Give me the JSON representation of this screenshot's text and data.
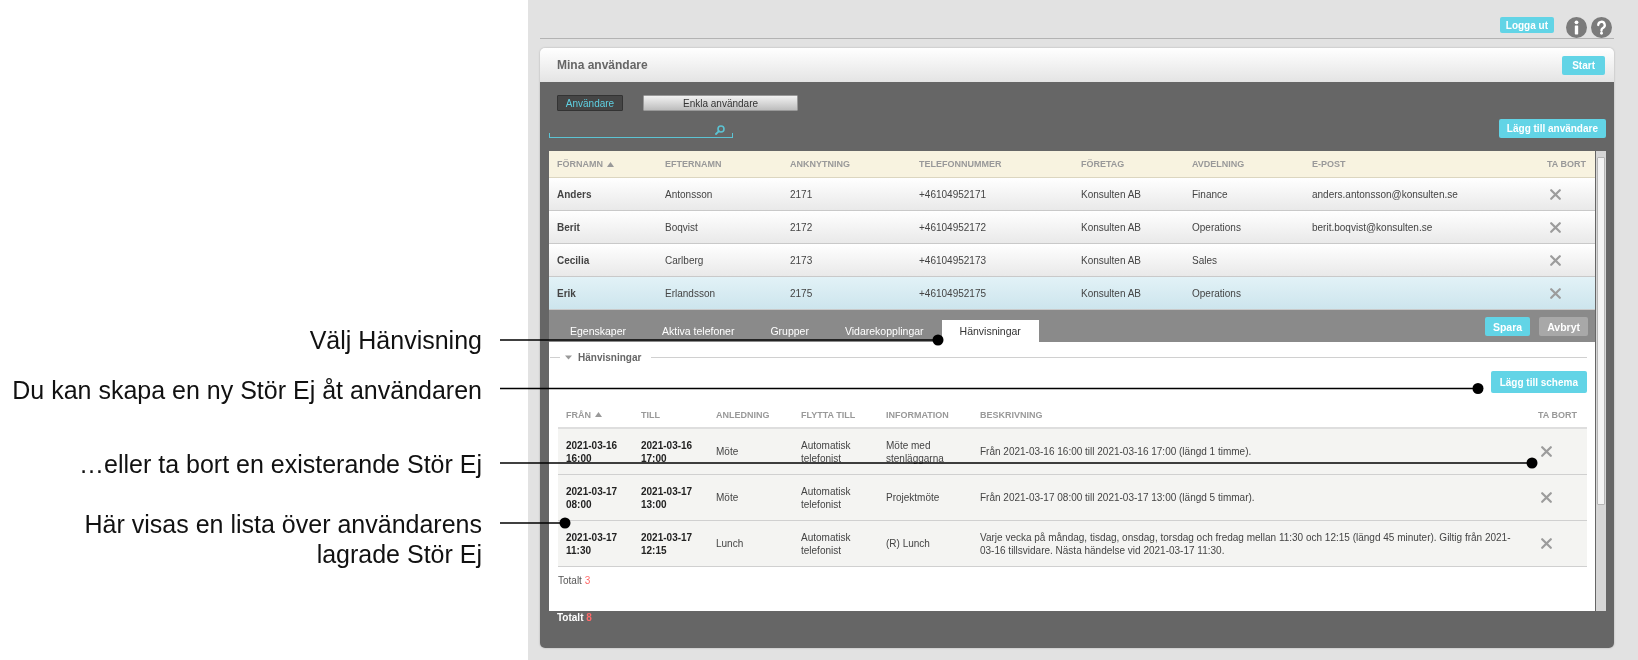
{
  "annotations": [
    {
      "text": "Välj Hänvisning"
    },
    {
      "text": "Du kan skapa en ny Stör Ej åt användaren"
    },
    {
      "text": "…eller ta bort en existerande Stör Ej"
    },
    {
      "text": "Här visas en lista över användarens lagrade Stör Ej"
    }
  ],
  "top_bar": {
    "logout_button": "Logga ut"
  },
  "panel": {
    "title": "Mina användare",
    "start_button": "Start"
  },
  "view_tabs": [
    {
      "label": "Användare",
      "selected": true
    },
    {
      "label": "Enkla användare",
      "selected": false
    }
  ],
  "add_user_button": "Lägg till användare",
  "users_table": {
    "columns": [
      {
        "label": "FÖRNAMN",
        "sorted": true
      },
      {
        "label": "EFTERNAMN",
        "sorted": false
      },
      {
        "label": "ANKNYTNING",
        "sorted": false
      },
      {
        "label": "TELEFONNUMMER",
        "sorted": false
      },
      {
        "label": "FÖRETAG",
        "sorted": false
      },
      {
        "label": "AVDELNING",
        "sorted": false
      },
      {
        "label": "E-POST",
        "sorted": false
      },
      {
        "label": "TA BORT",
        "sorted": false
      }
    ],
    "rows": [
      {
        "first_name": "Anders",
        "last_name": "Antonsson",
        "extension": "2171",
        "phone": "+46104952171",
        "company": "Konsulten AB",
        "department": "Finance",
        "email": "anders.antonsson@konsulten.se",
        "selected": false
      },
      {
        "first_name": "Berit",
        "last_name": "Boqvist",
        "extension": "2172",
        "phone": "+46104952172",
        "company": "Konsulten AB",
        "department": "Operations",
        "email": "berit.boqvist@konsulten.se",
        "selected": false
      },
      {
        "first_name": "Cecilia",
        "last_name": "Carlberg",
        "extension": "2173",
        "phone": "+46104952173",
        "company": "Konsulten AB",
        "department": "Sales",
        "selected": false
      },
      {
        "first_name": "Erik",
        "last_name": "Erlandsson",
        "extension": "2175",
        "phone": "+46104952175",
        "company": "Konsulten AB",
        "department": "Operations",
        "selected": true
      }
    ]
  },
  "detail_tabs": [
    {
      "label": "Egenskaper",
      "selected": false
    },
    {
      "label": "Aktiva telefoner",
      "selected": false
    },
    {
      "label": "Grupper",
      "selected": false
    },
    {
      "label": "Vidarekopplingar",
      "selected": false
    },
    {
      "label": "Hänvisningar",
      "selected": true
    }
  ],
  "detail_buttons": [
    {
      "label": "Spara",
      "kind": "primary"
    },
    {
      "label": "Avbryt",
      "kind": "secondary"
    }
  ],
  "section": {
    "title": "Hänvisningar",
    "expanded": true
  },
  "add_schedule_button": "Lägg till schema",
  "referrals_table": {
    "columns": [
      {
        "label": "FRÅN",
        "sorted": true
      },
      {
        "label": "TILL",
        "sorted": false
      },
      {
        "label": "ANLEDNING",
        "sorted": false
      },
      {
        "label": "FLYTTA TILL",
        "sorted": false
      },
      {
        "label": "INFORMATION",
        "sorted": false
      },
      {
        "label": "BESKRIVNING",
        "sorted": false
      },
      {
        "label": "TA BORT",
        "sorted": false
      }
    ],
    "rows": [
      {
        "from": "2021-03-16 16:00",
        "to": "2021-03-16 17:00",
        "reason": "Möte",
        "forward_to": "Automatisk telefonist",
        "information": "Möte med stenläggarna",
        "description": "Från 2021-03-16 16:00 till 2021-03-16 17:00 (längd 1 timme)."
      },
      {
        "from": "2021-03-17 08:00",
        "to": "2021-03-17 13:00",
        "reason": "Möte",
        "forward_to": "Automatisk telefonist",
        "information": "Projektmöte",
        "description": "Från 2021-03-17 08:00 till 2021-03-17 13:00 (längd 5 timmar)."
      },
      {
        "from": "2021-03-17 11:30",
        "to": "2021-03-17 12:15",
        "reason": "Lunch",
        "forward_to": "Automatisk telefonist",
        "information": "(R) Lunch",
        "description": "Varje vecka på måndag, tisdag, onsdag, torsdag och fredag mellan 11:30 och 12:15 (längd 45 minuter). Giltig från 2021-03-16 tillsvidare. Nästa händelse vid 2021-03-17 11:30."
      }
    ]
  },
  "referrals_total": {
    "label": "Totalt",
    "count": "3"
  },
  "users_total": {
    "label": "Totalt",
    "count": "8"
  }
}
